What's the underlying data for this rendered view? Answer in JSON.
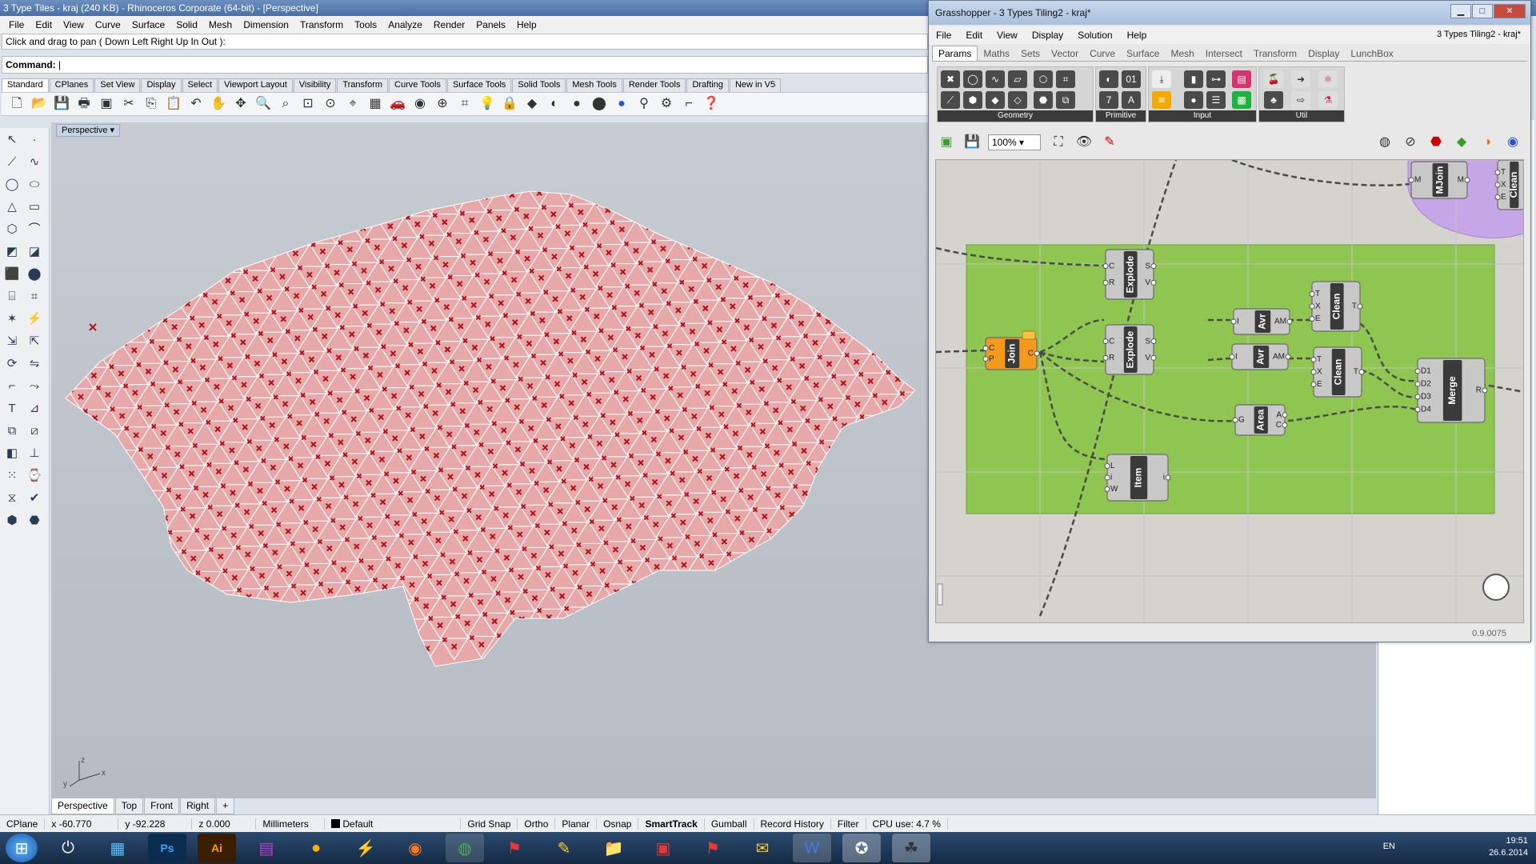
{
  "rhino": {
    "title": "3 Type Tiles - kraj (240 KB) - Rhinoceros Corporate (64-bit) - [Perspective]",
    "menu": [
      "File",
      "Edit",
      "View",
      "Curve",
      "Surface",
      "Solid",
      "Mesh",
      "Dimension",
      "Transform",
      "Tools",
      "Analyze",
      "Render",
      "Panels",
      "Help"
    ],
    "command_history": "Click and drag to pan ( Down  Left  Right  Up  In  Out ):",
    "command_label": "Command:",
    "toolbar_tabs": [
      "Standard",
      "CPlanes",
      "Set View",
      "Display",
      "Select",
      "Viewport Layout",
      "Visibility",
      "Transform",
      "Curve Tools",
      "Surface Tools",
      "Solid Tools",
      "Mesh Tools",
      "Render Tools",
      "Drafting",
      "New in V5"
    ],
    "viewport_label": "Perspective",
    "viewport_tabs": [
      "Perspective",
      "Top",
      "Front",
      "Right",
      "+"
    ],
    "status": {
      "cplane": "CPlane",
      "x": "x -60.770",
      "y": "y -92.228",
      "z": "z 0.000",
      "units": "Millimeters",
      "layer": "Default",
      "grid_snap": "Grid Snap",
      "ortho": "Ortho",
      "planar": "Planar",
      "osnap": "Osnap",
      "smarttrack": "SmartTrack",
      "gumball": "Gumball",
      "record_history": "Record History",
      "filter": "Filter",
      "cpu": "CPU use: 4.7 %"
    },
    "axes": {
      "x": "x",
      "y": "y",
      "z": "z"
    }
  },
  "grasshopper": {
    "title": "Grasshopper - 3 Types Tiling2 - kraj*",
    "menu": [
      "File",
      "Edit",
      "View",
      "Display",
      "Solution",
      "Help"
    ],
    "document": "3 Types Tiling2 - kraj*",
    "tabs": [
      "Params",
      "Maths",
      "Sets",
      "Vector",
      "Curve",
      "Surface",
      "Mesh",
      "Intersect",
      "Transform",
      "Display",
      "LunchBox"
    ],
    "ribbon_groups": [
      "Geometry",
      "Primitive",
      "Input",
      "Util"
    ],
    "zoom": "100%",
    "version": "0.9.0075",
    "components": {
      "join": {
        "name": "Join",
        "inputs": [
          "C",
          "P"
        ],
        "outputs": [
          "C"
        ]
      },
      "explode1": {
        "name": "Explode",
        "inputs": [
          "C",
          "R"
        ],
        "outputs": [
          "S",
          "V"
        ]
      },
      "explode2": {
        "name": "Explode",
        "inputs": [
          "C",
          "R"
        ],
        "outputs": [
          "S",
          "V"
        ]
      },
      "avr1": {
        "name": "Avr",
        "inputs": [
          "I"
        ],
        "outputs": [
          "AM"
        ]
      },
      "avr2": {
        "name": "Avr",
        "inputs": [
          "I"
        ],
        "outputs": [
          "AM"
        ]
      },
      "clean1": {
        "name": "Clean",
        "inputs": [
          "T",
          "X",
          "E"
        ],
        "outputs": [
          "T"
        ]
      },
      "clean2": {
        "name": "Clean",
        "inputs": [
          "T",
          "X",
          "E"
        ],
        "outputs": [
          "T"
        ]
      },
      "area": {
        "name": "Area",
        "inputs": [
          "G"
        ],
        "outputs": [
          "A",
          "C"
        ]
      },
      "item": {
        "name": "Item",
        "inputs": [
          "L",
          "i",
          "W"
        ],
        "outputs": [
          "i"
        ]
      },
      "merge": {
        "name": "Merge",
        "inputs": [
          "D1",
          "D2",
          "D3",
          "D4"
        ],
        "outputs": [
          "R"
        ]
      },
      "mjoin": {
        "name": "MJoin",
        "inputs": [
          "M"
        ],
        "outputs": [
          "M"
        ]
      },
      "clean3": {
        "name": "Clean",
        "inputs": [
          "T",
          "X",
          "E"
        ],
        "outputs": []
      }
    }
  },
  "taskbar": {
    "lang": "EN",
    "time": "19:51",
    "date": "26.6.2014"
  },
  "colors": {
    "group": "#8fc651",
    "mesh": "#e6a8a8",
    "mesh_edge": "#ffffff",
    "points": "#b0101a",
    "join": "#f39a1d"
  }
}
